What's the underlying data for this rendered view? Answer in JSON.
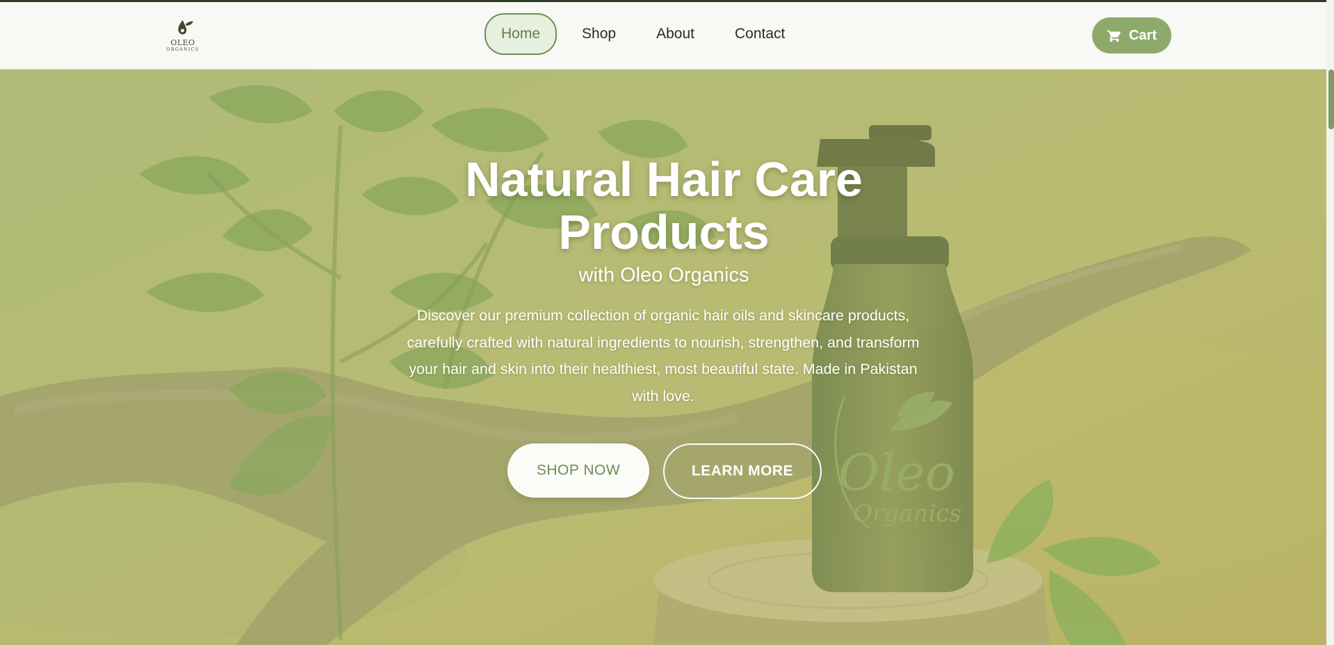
{
  "brand": {
    "logo_name": "OLEO",
    "logo_sub": "ORGANICS"
  },
  "nav": {
    "items": [
      {
        "label": "Home",
        "active": true
      },
      {
        "label": "Shop",
        "active": false
      },
      {
        "label": "About",
        "active": false
      },
      {
        "label": "Contact",
        "active": false
      }
    ]
  },
  "cart": {
    "label": "Cart",
    "icon": "cart-icon"
  },
  "hero": {
    "title": "Natural Hair Care Products",
    "subtitle": "with Oleo Organics",
    "description": "Discover our premium collection of organic hair oils and skincare products, carefully crafted with natural ingredients to nourish, strengthen, and transform your hair and skin into their healthiest, most beautiful state. Made in Pakistan with love.",
    "primary_cta": "SHOP NOW",
    "secondary_cta": "LEARN MORE",
    "bottle_label_main": "Oleo",
    "bottle_label_sub": "Organics"
  },
  "colors": {
    "accent": "#8eaa6a",
    "accent_dark": "#5f7f49",
    "header_bg": "#f8f8f5",
    "hero_overlay": "#b7b86c"
  }
}
